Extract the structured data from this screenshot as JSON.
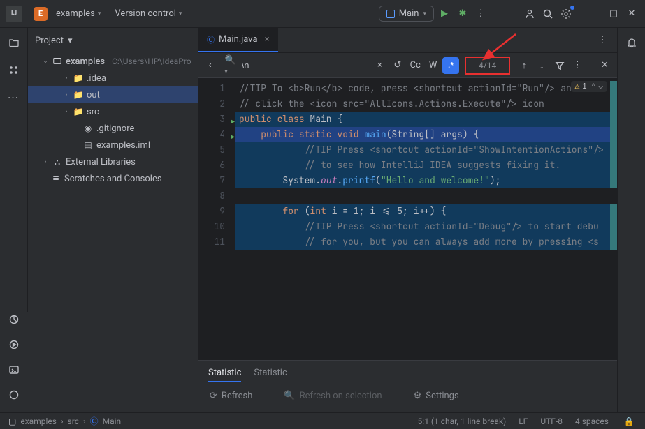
{
  "titlebar": {
    "project_letter": "E",
    "project": "examples",
    "vcs": "Version control",
    "run_config": "Main"
  },
  "sidebar": {
    "title": "Project",
    "root": "examples",
    "root_path": "C:\\Users\\HP\\IdeaPro",
    "items": [
      {
        "label": ".idea",
        "icon": "folder",
        "depth": 2,
        "caret": "›"
      },
      {
        "label": "out",
        "icon": "folder-o",
        "depth": 2,
        "caret": "›",
        "selected": true
      },
      {
        "label": "src",
        "icon": "folder-b",
        "depth": 2,
        "caret": "›"
      },
      {
        "label": ".gitignore",
        "icon": "gitignore",
        "depth": 3,
        "caret": ""
      },
      {
        "label": "examples.iml",
        "icon": "iml",
        "depth": 3,
        "caret": ""
      }
    ],
    "ext_lib": "External Libraries",
    "scratches": "Scratches and Consoles"
  },
  "tab": {
    "name": "Main.java"
  },
  "find": {
    "query": "\\n",
    "cc": "Cc",
    "w": "W",
    "regex": ".*",
    "count": "4/14"
  },
  "warn": {
    "count": "1"
  },
  "code": {
    "l2": "// click the <icon src=\"AllIcons.Actions.Execute\"/> icon ",
    "l4_sig": "(String[] args) {",
    "l5": "            //TIP Press <shortcut actionId=\"ShowIntentionActions\"/>",
    "l6": "            // to see how IntelliJ IDEA suggests fixing it.",
    "l7_str": "\"Hello and welcome!\"",
    "l9_a": " (",
    "l9_b": " i = 1; i <= 5; i++) {",
    "l10": "            //TIP Press <shortcut actionId=\"Debug\"/> to start debu",
    "l11": "            // for you, but you can always add more by pressing <s"
  },
  "panel": {
    "tab1": "Statistic",
    "tab2": "Statistic",
    "refresh": "Refresh",
    "refresh_sel": "Refresh on selection",
    "settings": "Settings"
  },
  "status": {
    "crumb1": "examples",
    "crumb2": "src",
    "crumb3": "Main",
    "pos": "5:1 (1 char, 1 line break)",
    "le": "LF",
    "enc": "UTF-8",
    "indent": "4 spaces"
  }
}
